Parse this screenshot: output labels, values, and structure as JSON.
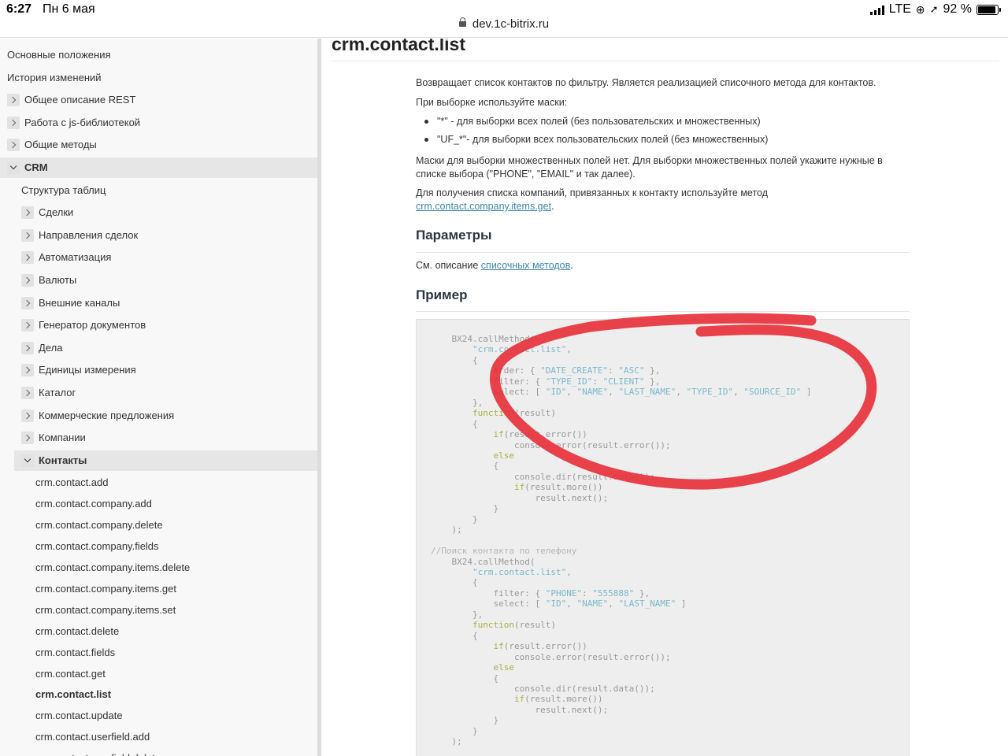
{
  "status": {
    "time": "6:27",
    "date": "Пн 6 мая",
    "network": "LTE",
    "battery": "92 %",
    "battery_level": 0.92
  },
  "url": "dev.1c-bitrix.ru",
  "sidebar": {
    "items": [
      {
        "label": "Основные положения",
        "chevron": "none"
      },
      {
        "label": "История изменений",
        "chevron": "none"
      },
      {
        "label": "Общее описание REST",
        "chevron": "right"
      },
      {
        "label": "Работа с js-библиотекой",
        "chevron": "right"
      },
      {
        "label": "Общие методы",
        "chevron": "right"
      },
      {
        "label": "CRM",
        "chevron": "down"
      },
      {
        "label": "Структура таблиц",
        "chevron": "none"
      },
      {
        "label": "Сделки",
        "chevron": "right"
      },
      {
        "label": "Направления сделок",
        "chevron": "right"
      },
      {
        "label": "Автоматизация",
        "chevron": "right"
      },
      {
        "label": "Валюты",
        "chevron": "right"
      },
      {
        "label": "Внешние каналы",
        "chevron": "right"
      },
      {
        "label": "Генератор документов",
        "chevron": "right"
      },
      {
        "label": "Дела",
        "chevron": "right"
      },
      {
        "label": "Единицы измерения",
        "chevron": "right"
      },
      {
        "label": "Каталог",
        "chevron": "right"
      },
      {
        "label": "Коммерческие предложения",
        "chevron": "right"
      },
      {
        "label": "Компании",
        "chevron": "right"
      },
      {
        "label": "Контакты",
        "chevron": "down"
      },
      {
        "label": "crm.contact.add",
        "chevron": "none"
      },
      {
        "label": "crm.contact.company.add",
        "chevron": "none"
      },
      {
        "label": "crm.contact.company.delete",
        "chevron": "none"
      },
      {
        "label": "crm.contact.company.fields",
        "chevron": "none"
      },
      {
        "label": "crm.contact.company.items.delete",
        "chevron": "none"
      },
      {
        "label": "crm.contact.company.items.get",
        "chevron": "none"
      },
      {
        "label": "crm.contact.company.items.set",
        "chevron": "none"
      },
      {
        "label": "crm.contact.delete",
        "chevron": "none"
      },
      {
        "label": "crm.contact.fields",
        "chevron": "none"
      },
      {
        "label": "crm.contact.get",
        "chevron": "none"
      },
      {
        "label": "crm.contact.list",
        "chevron": "none"
      },
      {
        "label": "crm.contact.update",
        "chevron": "none"
      },
      {
        "label": "crm.contact.userfield.add",
        "chevron": "none"
      },
      {
        "label": "crm.contact.userfield.delete",
        "chevron": "none"
      }
    ]
  },
  "main": {
    "title": "crm.contact.list",
    "intro": "Возвращает список контактов по фильтру. Является реализацией списочного метода для контактов.",
    "masks_intro": "При выборке используйте маски:",
    "masks": [
      "\"*\" - для выборки всех полей (без пользовательских и множественных)",
      "\"UF_*\"- для выборки всех пользовательских полей (без множественных)"
    ],
    "multi_p1": "Маски для выборки множественных полей нет. Для выборки множественных полей укажите нужные в",
    "multi_p2": "списке выбора (\"PHONE\", \"EMAIL\" и так далее).",
    "company_p1": "Для получения списка компаний, привязанных к контакту используйте метод",
    "company_link": "crm.contact.company.items.get",
    "company_dot": ".",
    "params_heading": "Параметры",
    "params_text": "См. описание ",
    "params_link": "списочных методов",
    "params_dot": ".",
    "example_heading": "Пример"
  },
  "code": [
    [
      [
        "t",
        "    BX24.callMethod("
      ]
    ],
    [
      [
        "t",
        "        "
      ],
      [
        "s",
        "\"crm.contact.list\""
      ],
      [
        "t",
        ","
      ]
    ],
    [
      [
        "t",
        "        {"
      ]
    ],
    [
      [
        "t",
        "            order: { "
      ],
      [
        "s",
        "\"DATE_CREATE\""
      ],
      [
        "t",
        ": "
      ],
      [
        "s",
        "\"ASC\""
      ],
      [
        "t",
        " },"
      ]
    ],
    [
      [
        "t",
        "            filter: { "
      ],
      [
        "s",
        "\"TYPE_ID\""
      ],
      [
        "t",
        ": "
      ],
      [
        "s",
        "\"CLIENT\""
      ],
      [
        "t",
        " },"
      ]
    ],
    [
      [
        "t",
        "            select: [ "
      ],
      [
        "s",
        "\"ID\""
      ],
      [
        "t",
        ", "
      ],
      [
        "s",
        "\"NAME\""
      ],
      [
        "t",
        ", "
      ],
      [
        "s",
        "\"LAST_NAME\""
      ],
      [
        "t",
        ", "
      ],
      [
        "s",
        "\"TYPE_ID\""
      ],
      [
        "t",
        ", "
      ],
      [
        "s",
        "\"SOURCE_ID\""
      ],
      [
        "t",
        " ]"
      ]
    ],
    [
      [
        "t",
        "        },"
      ]
    ],
    [
      [
        "t",
        "        "
      ],
      [
        "k",
        "function"
      ],
      [
        "t",
        "(result)"
      ]
    ],
    [
      [
        "t",
        "        {"
      ]
    ],
    [
      [
        "t",
        "            "
      ],
      [
        "k",
        "if"
      ],
      [
        "t",
        "(result.error())"
      ]
    ],
    [
      [
        "t",
        "                console.error(result.error());"
      ]
    ],
    [
      [
        "t",
        "            "
      ],
      [
        "k",
        "else"
      ]
    ],
    [
      [
        "t",
        "            {"
      ]
    ],
    [
      [
        "t",
        "                console.dir(result.data());"
      ]
    ],
    [
      [
        "t",
        "                "
      ],
      [
        "k",
        "if"
      ],
      [
        "t",
        "(result.more())"
      ]
    ],
    [
      [
        "t",
        "                    result.next();"
      ]
    ],
    [
      [
        "t",
        "            }"
      ]
    ],
    [
      [
        "t",
        "        }"
      ]
    ],
    [
      [
        "t",
        "    );"
      ]
    ],
    [
      [
        "t",
        ""
      ]
    ],
    [
      [
        "c",
        "//Поиск контакта по телефону"
      ]
    ],
    [
      [
        "t",
        "    BX24.callMethod("
      ]
    ],
    [
      [
        "t",
        "        "
      ],
      [
        "s",
        "\"crm.contact.list\""
      ],
      [
        "t",
        ","
      ]
    ],
    [
      [
        "t",
        "        {"
      ]
    ],
    [
      [
        "t",
        "            filter: { "
      ],
      [
        "s",
        "\"PHONE\""
      ],
      [
        "t",
        ": "
      ],
      [
        "s",
        "\"555888\""
      ],
      [
        "t",
        " },"
      ]
    ],
    [
      [
        "t",
        "            select: [ "
      ],
      [
        "s",
        "\"ID\""
      ],
      [
        "t",
        ", "
      ],
      [
        "s",
        "\"NAME\""
      ],
      [
        "t",
        ", "
      ],
      [
        "s",
        "\"LAST_NAME\""
      ],
      [
        "t",
        " ]"
      ]
    ],
    [
      [
        "t",
        "        },"
      ]
    ],
    [
      [
        "t",
        "        "
      ],
      [
        "k",
        "function"
      ],
      [
        "t",
        "(result)"
      ]
    ],
    [
      [
        "t",
        "        {"
      ]
    ],
    [
      [
        "t",
        "            "
      ],
      [
        "k",
        "if"
      ],
      [
        "t",
        "(result.error())"
      ]
    ],
    [
      [
        "t",
        "                console.error(result.error());"
      ]
    ],
    [
      [
        "t",
        "            "
      ],
      [
        "k",
        "else"
      ]
    ],
    [
      [
        "t",
        "            {"
      ]
    ],
    [
      [
        "t",
        "                console.dir(result.data());"
      ]
    ],
    [
      [
        "t",
        "                "
      ],
      [
        "k",
        "if"
      ],
      [
        "t",
        "(result.more())"
      ]
    ],
    [
      [
        "t",
        "                    result.next();"
      ]
    ],
    [
      [
        "t",
        "            }"
      ]
    ],
    [
      [
        "t",
        "        }"
      ]
    ],
    [
      [
        "t",
        "    );"
      ]
    ]
  ],
  "colors": {
    "annotation": "#e8323c",
    "link": "#3d86a8",
    "string": "#7ab8cc",
    "keyword": "#a7b040"
  }
}
